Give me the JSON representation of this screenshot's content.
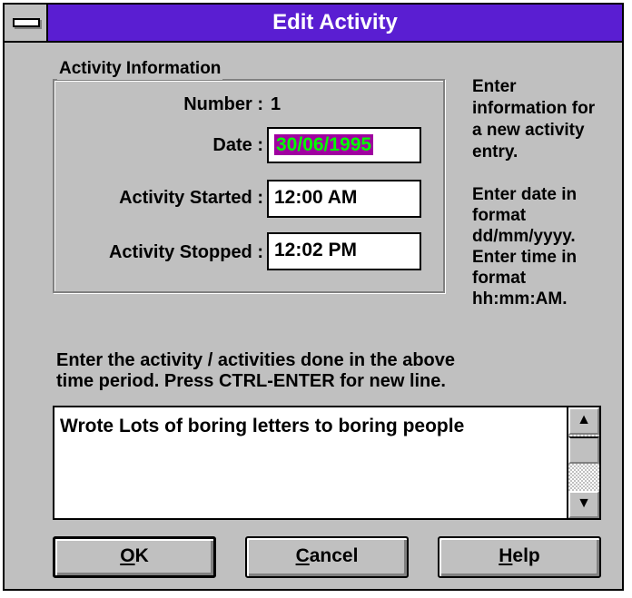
{
  "window": {
    "title": "Edit Activity"
  },
  "group": {
    "label": "Activity Information",
    "number_label": "Number :",
    "number_value": "1",
    "date_label": "Date :",
    "date_value": "30/06/1995",
    "started_label": "Activity Started :",
    "started_value": "12:00 AM",
    "stopped_label": "Activity Stopped :",
    "stopped_value": "12:02 PM"
  },
  "side_help": {
    "line1": [
      "Enter",
      "information for",
      "a new activity",
      "entry."
    ],
    "line2": [
      "Enter date in",
      "format",
      "dd/mm/yyyy.",
      "Enter time in",
      "format",
      "hh:mm:AM."
    ]
  },
  "instructions": {
    "line1": "Enter the activity / activities done in the above",
    "line2": "time period. Press CTRL-ENTER for new line."
  },
  "memo": {
    "text": "Wrote Lots of boring letters to boring people"
  },
  "buttons": {
    "ok": {
      "mnemonic": "O",
      "rest": "K"
    },
    "cancel": {
      "mnemonic": "C",
      "rest": "ancel"
    },
    "help": {
      "mnemonic": "H",
      "rest": "elp"
    }
  },
  "icons": {
    "system_menu": "system-menu-icon",
    "scroll_up": "arrow-up-icon",
    "scroll_down": "arrow-down-icon"
  },
  "colors": {
    "titlebar": "#5a1ed2",
    "dialog_bg": "#c0c0c0",
    "selection_bg": "#a000a0",
    "selection_text": "#00ff00"
  }
}
